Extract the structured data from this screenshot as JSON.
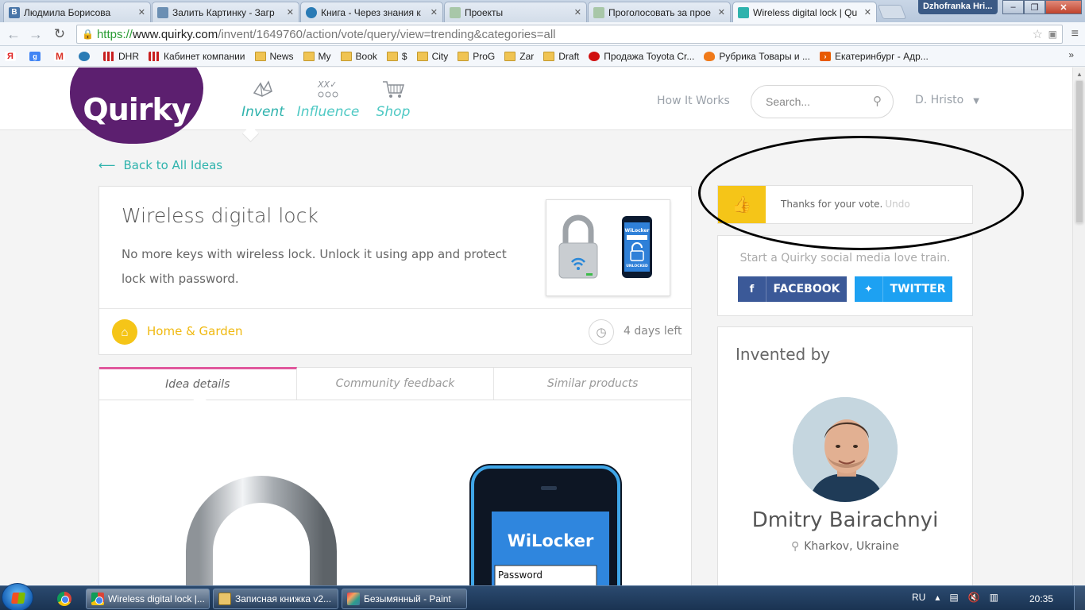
{
  "browser": {
    "tabs": [
      {
        "label": "Людмила Борисова",
        "icon": "vk-icon",
        "color": "#4a76a8"
      },
      {
        "label": "Залить Картинку - Загр",
        "icon": "image-icon",
        "color": "#6b8fb3"
      },
      {
        "label": "Книга - Через знания к",
        "icon": "book-icon",
        "color": "#2a7bb5"
      },
      {
        "label": "Проекты",
        "icon": "page-icon",
        "color": "#8fb08f"
      },
      {
        "label": "Проголосовать за прое",
        "icon": "page-icon",
        "color": "#8fb08f"
      },
      {
        "label": "Wireless digital lock | Qu",
        "icon": "quirky-icon",
        "color": "#2fb3ad"
      }
    ],
    "user_badge": "Dzhofranka Hri...",
    "url": {
      "scheme": "https://",
      "host": "www.quirky.com",
      "path": "/invent/1649760/action/vote/query/view=trending&categories=all"
    },
    "bookmarks": [
      {
        "label": "",
        "icon": "yandex-icon",
        "color": "#e02020"
      },
      {
        "label": "",
        "icon": "google-icon",
        "color": "#4285f4"
      },
      {
        "label": "",
        "icon": "gmail-icon",
        "color": "#d93025"
      },
      {
        "label": "",
        "icon": "site-icon",
        "color": "#2a7bb5"
      },
      {
        "label": "DHR",
        "icon": "bars-icon",
        "color": "#c81e1e"
      },
      {
        "label": "Кабинет компании",
        "icon": "bars-icon",
        "color": "#c81e1e"
      },
      {
        "label": "News",
        "icon": "folder-icon",
        "color": "#f0c453"
      },
      {
        "label": "My",
        "icon": "folder-icon",
        "color": "#f0c453"
      },
      {
        "label": "Book",
        "icon": "folder-icon",
        "color": "#f0c453"
      },
      {
        "label": "$",
        "icon": "folder-icon",
        "color": "#f0c453"
      },
      {
        "label": "City",
        "icon": "folder-icon",
        "color": "#f0c453"
      },
      {
        "label": "ProG",
        "icon": "folder-icon",
        "color": "#f0c453"
      },
      {
        "label": "Zar",
        "icon": "folder-icon",
        "color": "#f0c453"
      },
      {
        "label": "Draft",
        "icon": "folder-icon",
        "color": "#f0c453"
      },
      {
        "label": "Продажа Toyota Cr...",
        "icon": "auto-icon",
        "color": "#d01010"
      },
      {
        "label": "Рубрика Товары и ...",
        "icon": "fire-icon",
        "color": "#f07a1a"
      },
      {
        "label": "Екатеринбург - Адр...",
        "icon": "arrow-icon",
        "color": "#e85a00"
      }
    ],
    "bookmarks_more": "»"
  },
  "site": {
    "logo": "Quirky",
    "nav": [
      {
        "label": "Invent",
        "icon": "invent-icon"
      },
      {
        "label": "Influence",
        "icon": "influence-icon"
      },
      {
        "label": "Shop",
        "icon": "cart-icon"
      }
    ],
    "how_it_works": "How It Works",
    "search_placeholder": "Search...",
    "user": "D. Hristo",
    "accent": "#2fb3ad",
    "brand_purple": "#5c1f6f"
  },
  "idea": {
    "back_link": "Back to All Ideas",
    "title": "Wireless digital lock",
    "description": "No more keys with wireless lock. Unlock it using app and protect lock with password.",
    "category": "Home & Garden",
    "time_left": "4 days left",
    "thumb_app_title": "WiLocker",
    "thumb_app_status": "UNLOCKED"
  },
  "tabs": [
    {
      "label": "Idea details",
      "active": true
    },
    {
      "label": "Community feedback",
      "active": false
    },
    {
      "label": "Similar products",
      "active": false
    }
  ],
  "details": {
    "app_title": "WiLocker",
    "password_label": "Password"
  },
  "vote": {
    "message": "Thanks for your vote.",
    "undo": "Undo"
  },
  "share": {
    "text": "Start a Quirky social media love train.",
    "facebook": "FACEBOOK",
    "twitter": "TWITTER"
  },
  "inventor": {
    "heading": "Invented by",
    "name": "Dmitry Bairachnyi",
    "location": "Kharkov, Ukraine"
  },
  "taskbar": {
    "items": [
      {
        "label": "Wireless digital lock |...",
        "icon": "chrome-icon"
      },
      {
        "label": "Записная книжка v2...",
        "icon": "notebook-icon"
      },
      {
        "label": "Безымянный - Paint",
        "icon": "paint-icon"
      }
    ],
    "lang": "RU",
    "time": "20:35"
  }
}
